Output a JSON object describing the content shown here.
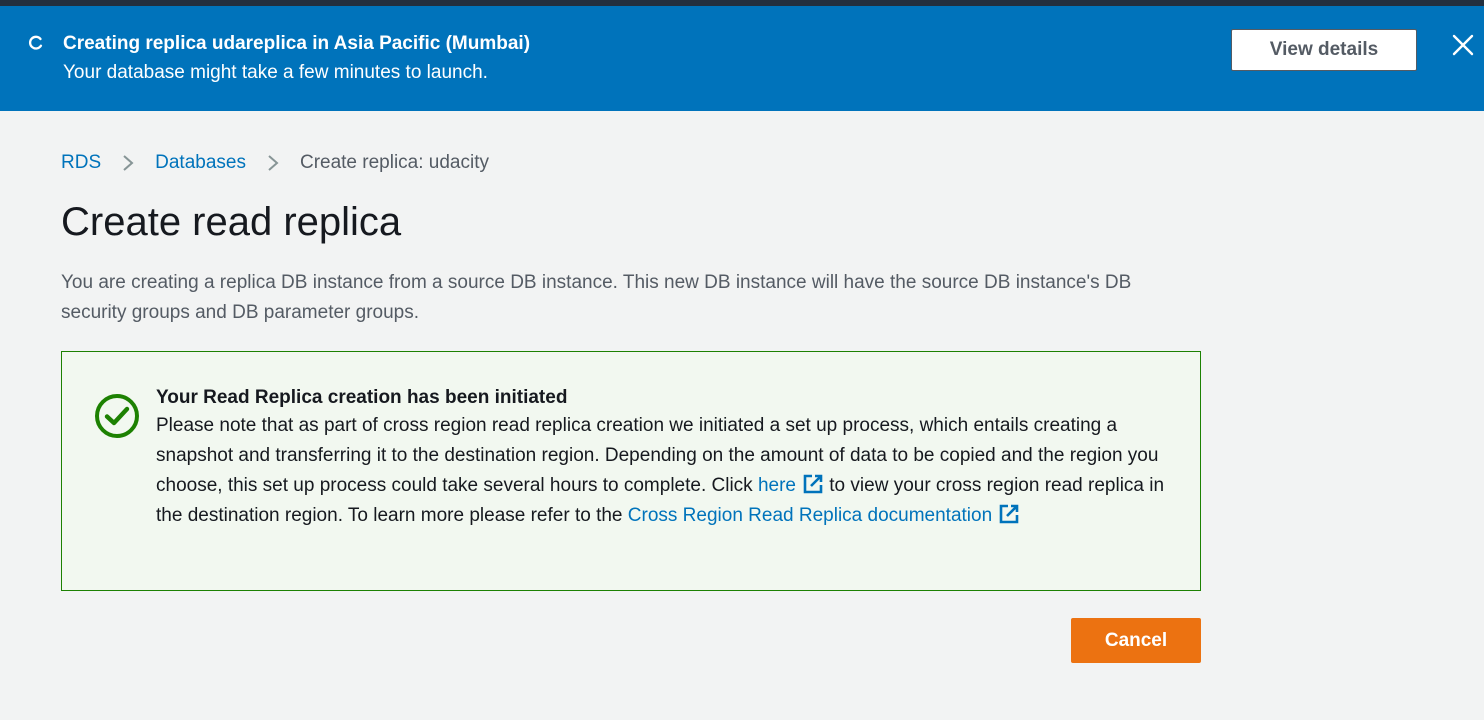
{
  "flashbar": {
    "title": "Creating replica udareplica in Asia Pacific (Mumbai)",
    "message": "Your database might take a few minutes to launch.",
    "view_details_label": "View details",
    "spinner_icon": "loading-spinner-icon",
    "close_icon": "close-icon",
    "background_color": "#0073bb"
  },
  "breadcrumb": {
    "items": [
      {
        "label": "RDS"
      },
      {
        "label": "Databases"
      },
      {
        "label": "Create replica: udacity"
      }
    ],
    "separator_icon": "chevron-right-icon"
  },
  "page": {
    "title": "Create read replica",
    "description": "You are creating a replica DB instance from a source DB instance. This new DB instance will have the source DB instance's DB security groups and DB parameter groups."
  },
  "alert": {
    "icon": "success-check-icon",
    "title": "Your Read Replica creation has been initiated",
    "body_part1": "Please note that as part of cross region read replica creation we initiated a set up process, which entails creating a snapshot and transferring it to the destination region. Depending on the amount of data to be copied and the region you choose, this set up process could take several hours to complete. Click ",
    "link_here": "here",
    "body_part2": " to view your cross region read replica in the destination region. To learn more please refer to the ",
    "link_docs": "Cross Region Read Replica documentation",
    "external_link_icon": "external-link-icon",
    "border_color": "#1d8102"
  },
  "actions": {
    "cancel_label": "Cancel",
    "cancel_color": "#ec7211"
  }
}
